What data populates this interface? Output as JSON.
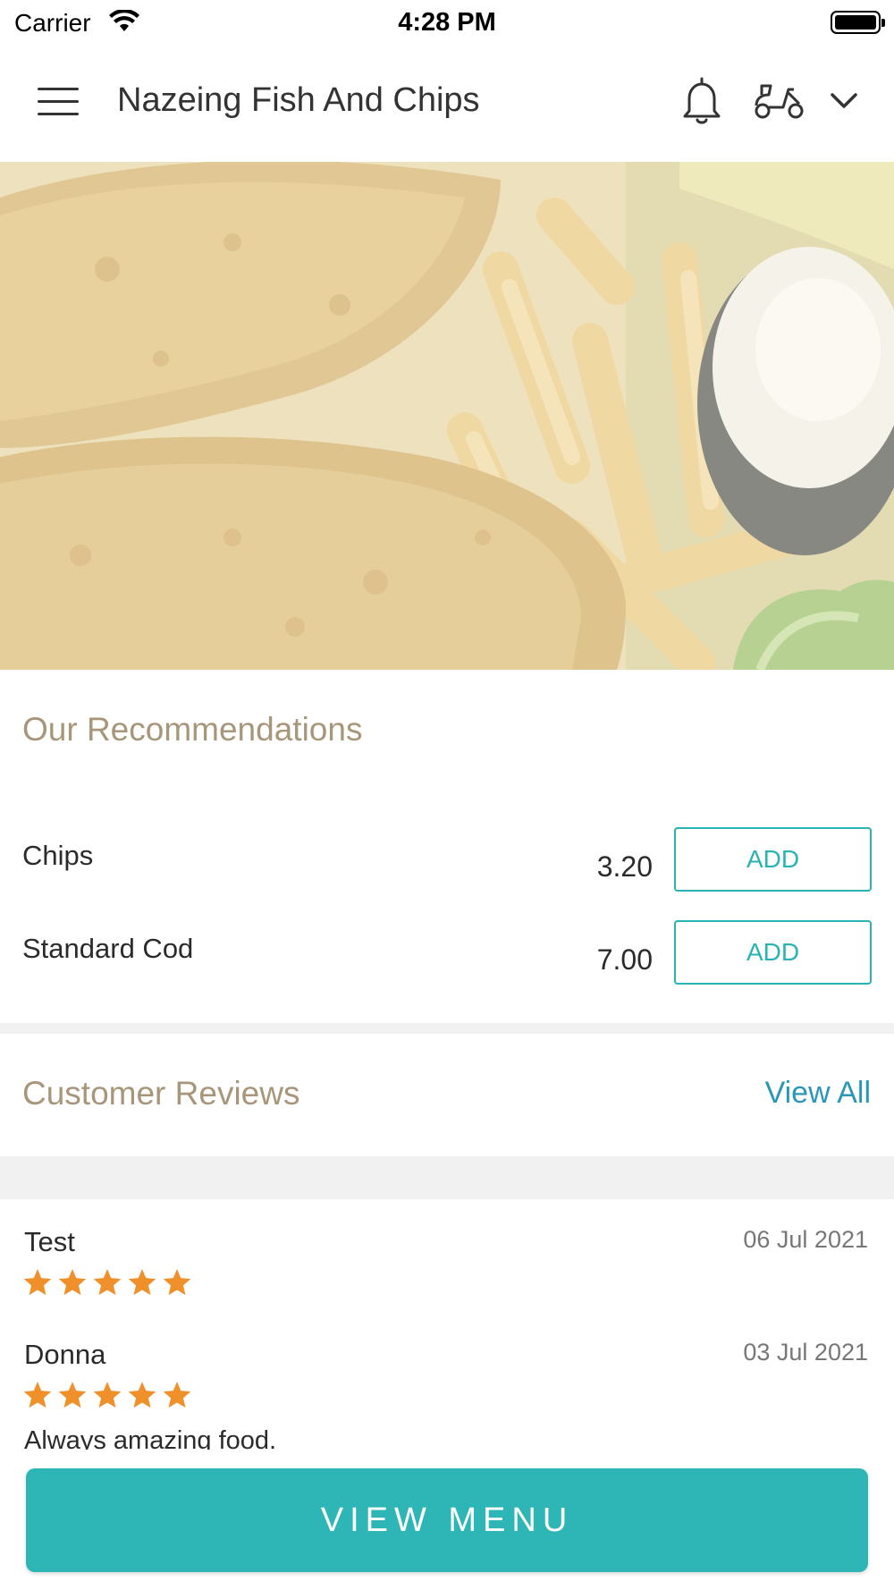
{
  "status_bar": {
    "carrier": "Carrier",
    "time": "4:28 PM"
  },
  "nav": {
    "title": "Nazeing Fish And Chips",
    "icons": [
      "menu-icon",
      "bell-icon",
      "scooter-icon",
      "chevron-down-icon"
    ]
  },
  "hero": {
    "image": "fish-and-chips-photo"
  },
  "recommendations": {
    "heading": "Our Recommendations",
    "items": [
      {
        "name": "Chips",
        "price": "3.20",
        "button": "ADD"
      },
      {
        "name": "Standard Cod",
        "price": "7.00",
        "button": "ADD"
      }
    ]
  },
  "reviews": {
    "heading": "Customer Reviews",
    "view_all": "View All",
    "items": [
      {
        "name": "Test",
        "date": "06 Jul 2021",
        "rating": 5,
        "text": ""
      },
      {
        "name": "Donna",
        "date": "03 Jul 2021",
        "rating": 5,
        "text": "Always amazing food."
      }
    ]
  },
  "footer": {
    "view_menu": "VIEW MENU"
  },
  "colors": {
    "accent": "#2eb5b5",
    "heading": "#a8967a",
    "link": "#2a97b8",
    "star": "#f0902a"
  }
}
